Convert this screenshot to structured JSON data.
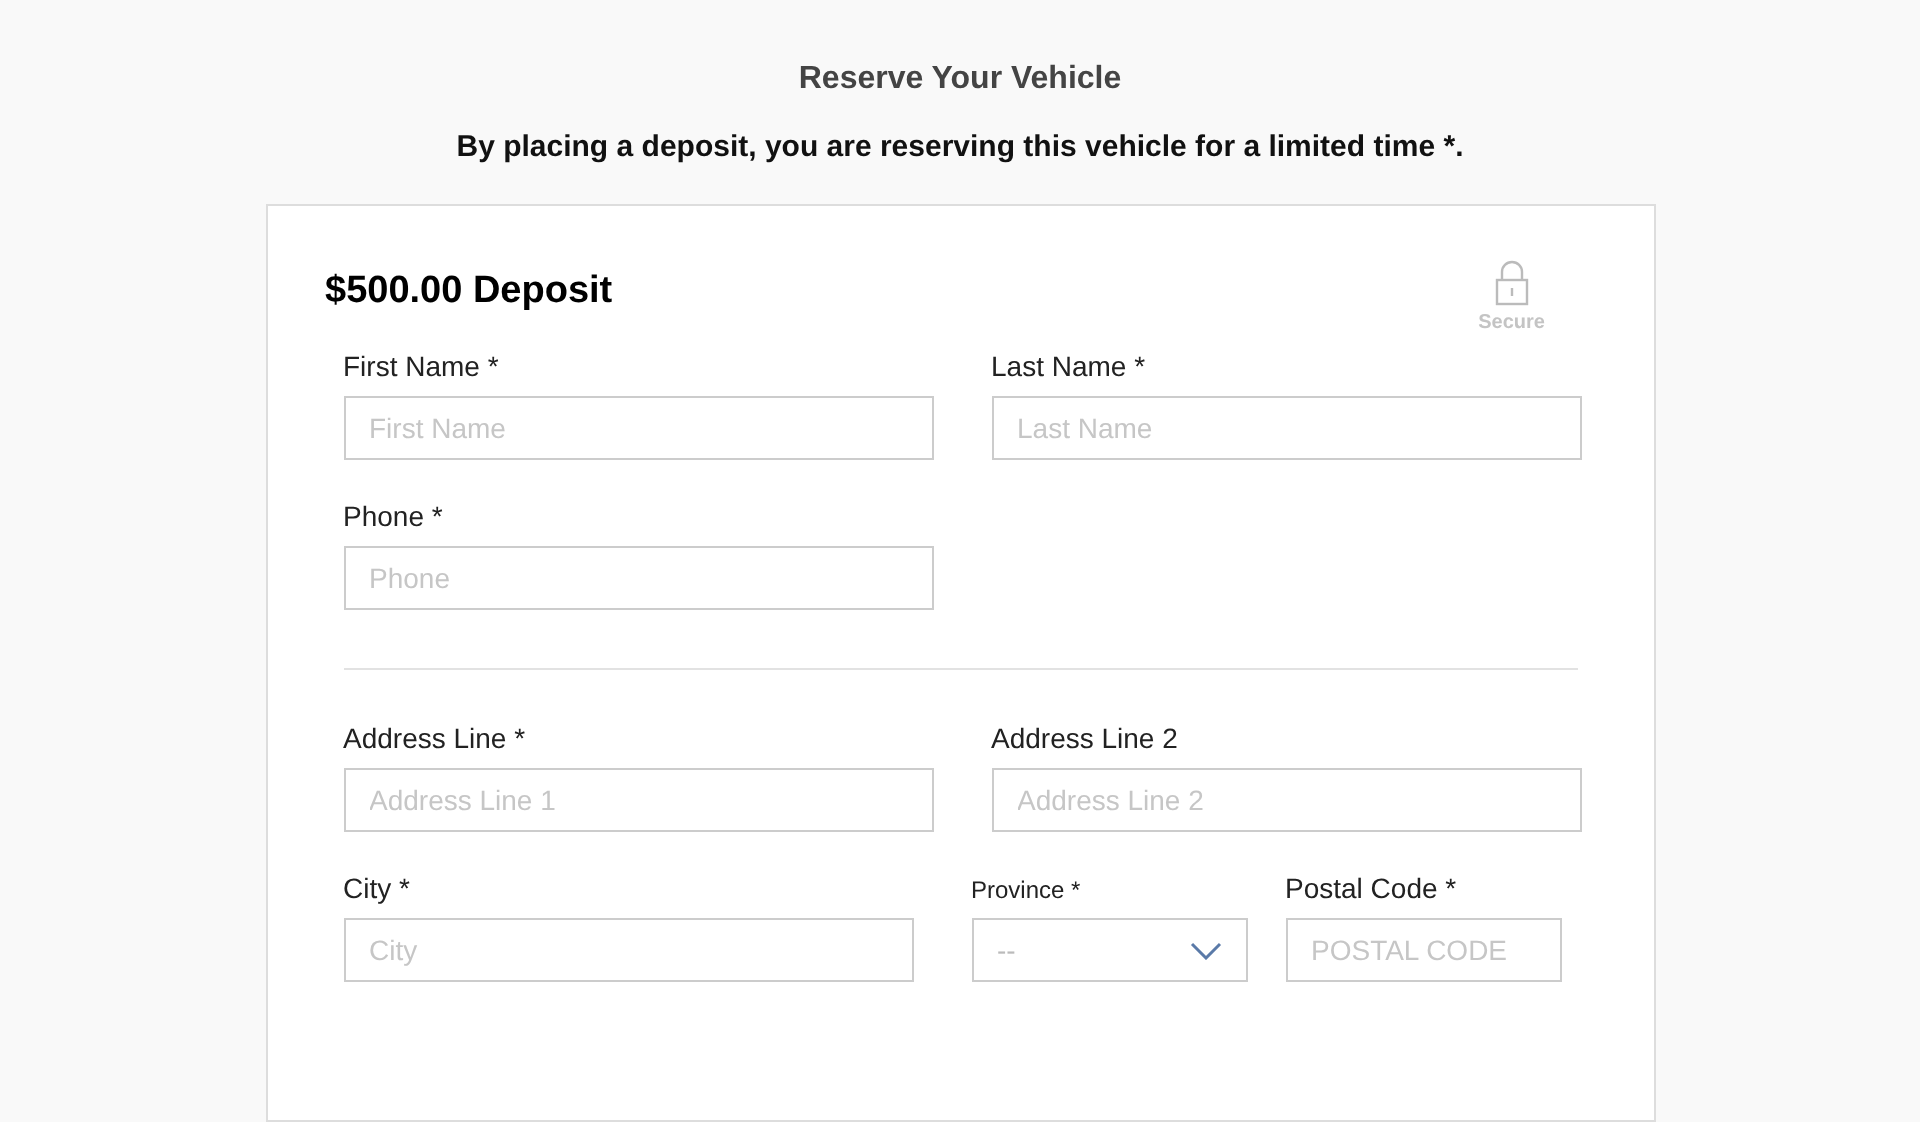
{
  "header": {
    "title": "Reserve Your Vehicle",
    "subtitle": "By placing a deposit, you are reserving this vehicle for a limited time *."
  },
  "card": {
    "title": "$500.00 Deposit",
    "secure_label": "Secure",
    "sections": [
      [
        [
          {
            "kind": "input",
            "label": "First Name *",
            "placeholder": "First Name"
          },
          {
            "kind": "input",
            "label": "Last Name *",
            "placeholder": "Last Name"
          }
        ],
        [
          {
            "kind": "input",
            "label": "Phone *",
            "placeholder": "Phone"
          }
        ]
      ],
      [
        [
          {
            "kind": "input",
            "label": "Address Line *",
            "placeholder": "Address Line 1"
          },
          {
            "kind": "input",
            "label": "Address Line 2",
            "placeholder": "Address Line 2"
          }
        ],
        [
          {
            "kind": "input",
            "label": "City *",
            "placeholder": "City"
          },
          {
            "kind": "select",
            "label": "Province *",
            "value": "--"
          },
          {
            "kind": "input",
            "label": "Postal Code *",
            "placeholder": "POSTAL CODE"
          }
        ]
      ]
    ]
  }
}
